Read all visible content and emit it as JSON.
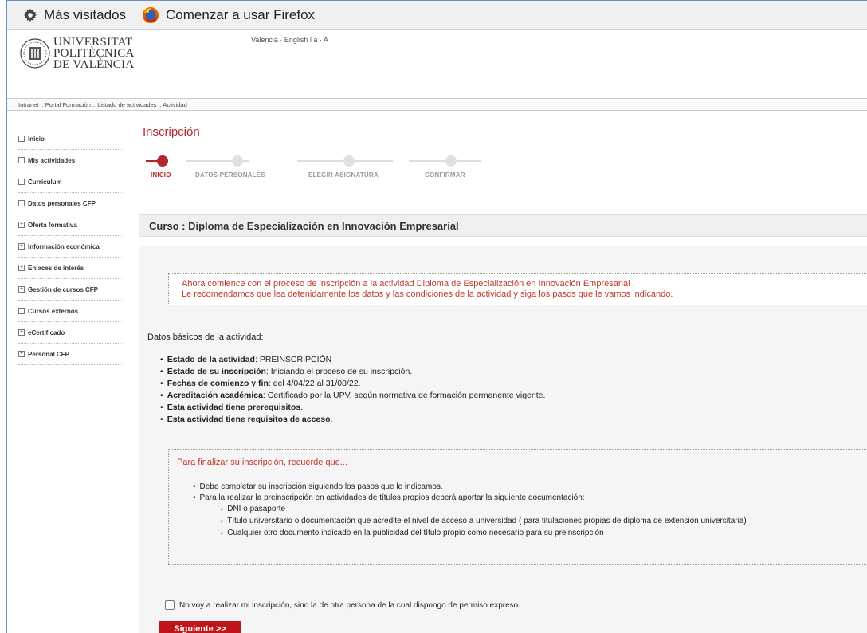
{
  "bookmarks": [
    {
      "label": "Más visitados",
      "icon": "gear-icon"
    },
    {
      "label": "Comenzar a usar Firefox",
      "icon": "firefox-icon"
    }
  ],
  "header": {
    "logo_lines": [
      "UNIVERSITAT",
      "POLITÈCNICA",
      "DE VALÈNCIA"
    ],
    "languages": "Valencià · English  l  a · A"
  },
  "breadcrumb": "Intranet ::  Portal Formación  :: Listado de actividades  :: Actividad",
  "sidebar": {
    "items": [
      {
        "label": "Inicio",
        "marker": ""
      },
      {
        "label": "Mis actividades",
        "marker": ""
      },
      {
        "label": "Currículum",
        "marker": ""
      },
      {
        "label": "Datos personales CFP",
        "marker": ""
      },
      {
        "label": "Oferta formativa",
        "marker": "+"
      },
      {
        "label": "Información económica",
        "marker": "+"
      },
      {
        "label": "Enlaces de interés",
        "marker": "+"
      },
      {
        "label": "Gestión de cursos CFP",
        "marker": "+"
      },
      {
        "label": "Cursos externos",
        "marker": ""
      },
      {
        "label": "eCertificado",
        "marker": "+"
      },
      {
        "label": "Personal CFP",
        "marker": "+"
      }
    ]
  },
  "main": {
    "title": "Inscripción",
    "steps": [
      {
        "label": "INICIO",
        "active": true
      },
      {
        "label": "DATOS PERSONALES",
        "active": false
      },
      {
        "label": "ELEGIR ASIGNATURA",
        "active": false
      },
      {
        "label": "CONFIRMAR",
        "active": false
      }
    ],
    "course": "Curso : Diploma de Especialización en Innovación Empresarial",
    "notice_line1": "Ahora comience con el proceso de inscripción a la actividad Diploma de Especialización en Innovación Empresarial .",
    "notice_line2": "Le recomendamos que lea detenidamente los datos y las condiciones de la actividad y siga los pasos que le vamos indicando.",
    "basic_title": "Datos básicos de la actividad:",
    "basic": [
      {
        "key": "Estado de la actividad",
        "value": ": PREINSCRIPCIÓN"
      },
      {
        "key": "Estado de su inscripción",
        "value": ": Iniciando el proceso de su inscripción."
      },
      {
        "key": "Fechas de comienzo y fin",
        "value": ": del 4/04/22 al 31/08/22."
      },
      {
        "key": "Acreditación académica",
        "value": ": Certificado por la UPV, según normativa de formación permanente vigente."
      },
      {
        "key": "Esta actividad tiene prerequisitos",
        "value": "."
      },
      {
        "key": "Esta actividad tiene requisitos de acceso",
        "value": "."
      }
    ],
    "finalize_title": "Para finalizar su inscripción, recuerde que...",
    "finalize_item1": "Debe completar su inscripción siguiendo los pasos que le indicamos.",
    "finalize_item2": "Para la realizar la preinscripción en actividades de títulos propios deberá aportar la siguiente documentación:",
    "finalize_sub": [
      "DNI o pasaporte",
      "Título universitario o documentación que acredite el nivel de acceso a universidad ( para titulaciones propias de diploma de extensión universitaria)",
      "Cualquier otro documento indicado en la publicidad del título propio como necesario para su preinscripción"
    ],
    "consent_label": "No voy a realizar mi inscripción, sino la de otra persona de la cual dispongo de permiso expreso.",
    "next_label": "Siguiente >>"
  }
}
